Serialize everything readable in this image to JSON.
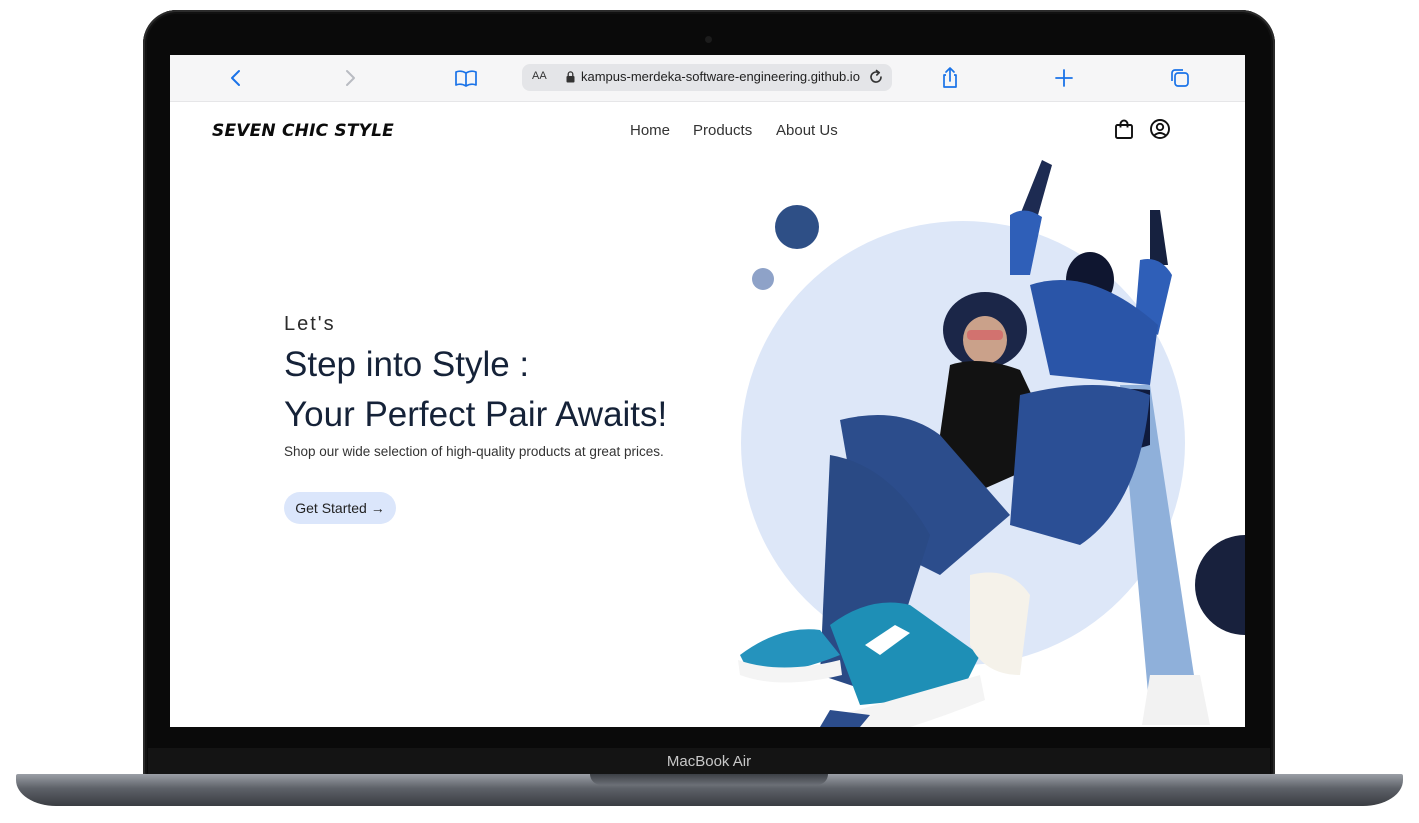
{
  "device": {
    "label": "MacBook Air"
  },
  "browser": {
    "text_size_label": "AA",
    "url": "kampus-merdeka-software-engineering.github.io"
  },
  "site": {
    "logo": "SEVEN CHIC STYLE",
    "nav": [
      "Home",
      "Products",
      "About Us"
    ]
  },
  "hero": {
    "eyebrow": "Let's",
    "title_line1": "Step into Style :",
    "title_line2": "Your Perfect Pair Awaits!",
    "subtitle": "Shop our wide selection of high-quality products at great prices.",
    "cta_label": "Get Started →"
  },
  "icons": {
    "back": "chevron-left-icon",
    "forward": "chevron-right-icon",
    "bookmarks": "book-icon",
    "lock": "lock-icon",
    "reload": "reload-icon",
    "share": "share-icon",
    "new_tab": "plus-icon",
    "tabs": "tabs-icon",
    "cart": "shopping-bag-icon",
    "account": "user-circle-icon"
  },
  "colors": {
    "accent": "#1a73e8",
    "navy": "#152238",
    "cta_bg": "#dbe6fb",
    "circle_light": "#dde7f8",
    "circle_mid": "#2e4f86",
    "circle_small": "#8ea2c8",
    "circle_dark": "#18213d"
  }
}
